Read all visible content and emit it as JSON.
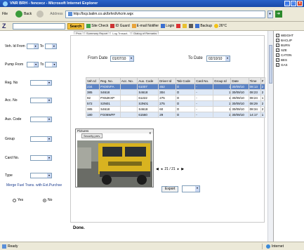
{
  "window": {
    "title": "VNR BRH - fencecz - Microsoft Internet Explorer"
  },
  "toolbar": {
    "file": "File",
    "back": "Back",
    "address_label": "Address",
    "address": "http://bcp.balim.co.uk/brhrd/vhcrin.wgx"
  },
  "bar2": {
    "logo": "Z",
    "search": "Search",
    "items": [
      "Site Check",
      "ID Guard",
      "E-mail Notifier",
      "Login",
      "Backup",
      "26°C"
    ]
  },
  "filters": {
    "veh_id_from": "Veh. Id From",
    "to1": "To",
    "pump_from": "Pump From",
    "to2": "To",
    "reg_no": "Reg. No",
    "acc_no": "Acc. No",
    "aux_code": "Aux. Code",
    "group": "Group",
    "card_no": "Card No.",
    "type": "Type",
    "merge": "Merge Fuel Trans. with Ext.Purchse",
    "yes": "Yes",
    "no": "No"
  },
  "tabs": [
    "Prcs",
    "Summary Report",
    "Log Trnsact..",
    "Dialog of Remarks"
  ],
  "dates": {
    "from_label": "From Date",
    "from_value": "01/07/10",
    "to_label": "To Date",
    "to_value": "02/10/10"
  },
  "grid": {
    "columns": [
      "Veh Id",
      "Reg. No.",
      "Acc. No.",
      "Aux. Code",
      "Driver Id",
      "Tab Code",
      "Card No.",
      "Group Id",
      "Date",
      "Time",
      "F"
    ],
    "rows": [
      [
        "234",
        "PX00VFA",
        "",
        "61007",
        "452",
        "O",
        "-",
        "1",
        "30/09/10",
        "08:13",
        "2"
      ],
      [
        "385",
        "S4618",
        "",
        "S4618",
        "304",
        "O",
        "-",
        "1",
        "30/09/10",
        "08:23",
        "2"
      ],
      [
        "92",
        "PX62KXP",
        "",
        "61222",
        "275",
        "O",
        "-",
        "1",
        "30/09/10",
        "08:24",
        "1"
      ],
      [
        "572",
        "S3N01",
        "",
        "S3N01",
        "275",
        "O",
        "-",
        "1",
        "30/09/10",
        "08:29",
        "2"
      ],
      [
        "385",
        "S4618",
        "",
        "S4618",
        "60",
        "O",
        "-",
        "1",
        "30/09/10",
        "08:34",
        "2"
      ],
      [
        "180",
        "FG06WFF",
        "",
        "61560",
        "29",
        "O",
        "-",
        "1",
        "30/09/10",
        "14:17",
        "1"
      ]
    ]
  },
  "popup": {
    "title": "Pictures",
    "button": "Security prev.",
    "close": "x"
  },
  "pager": {
    "text": "21 / 21"
  },
  "export": {
    "label": "Export"
  },
  "checks": [
    "WEIGHT",
    "BACLIP",
    "BURN",
    "SZE",
    "CATON",
    "BES",
    "GAS"
  ],
  "status": {
    "left": "Done.",
    "ready": "Ready",
    "zone": "Internet"
  }
}
